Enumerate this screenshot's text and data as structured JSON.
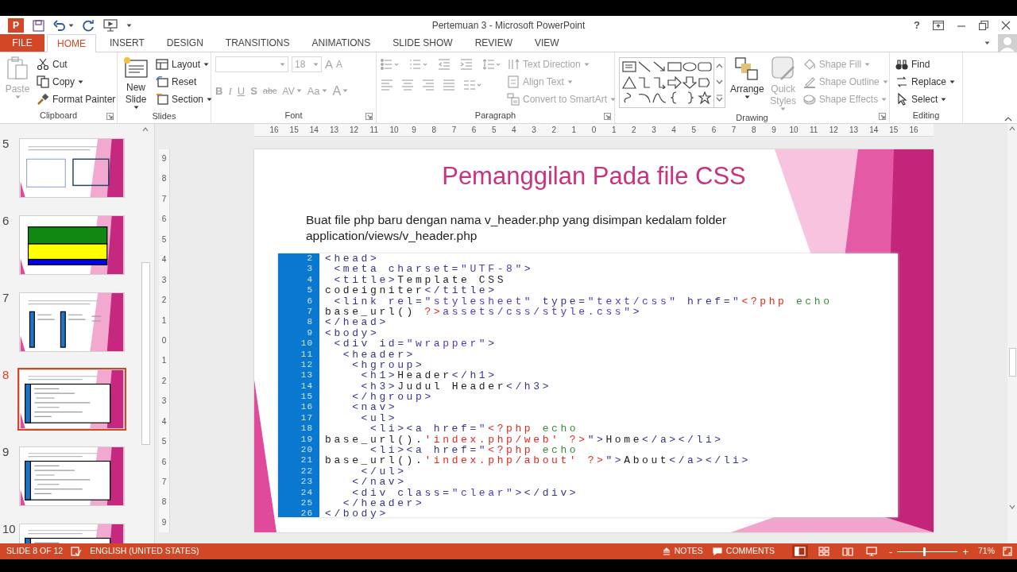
{
  "title_bar": {
    "logo_letter": "P",
    "title": "Pertemuan 3 - Microsoft PowerPoint",
    "help": "?"
  },
  "tabs": [
    {
      "label": "FILE",
      "kind": "file",
      "selected": false
    },
    {
      "label": "HOME",
      "kind": "tab",
      "selected": true
    },
    {
      "label": "INSERT",
      "kind": "tab",
      "selected": false
    },
    {
      "label": "DESIGN",
      "kind": "tab",
      "selected": false
    },
    {
      "label": "TRANSITIONS",
      "kind": "tab",
      "selected": false
    },
    {
      "label": "ANIMATIONS",
      "kind": "tab",
      "selected": false
    },
    {
      "label": "SLIDE SHOW",
      "kind": "tab",
      "selected": false
    },
    {
      "label": "REVIEW",
      "kind": "tab",
      "selected": false
    },
    {
      "label": "VIEW",
      "kind": "tab",
      "selected": false
    }
  ],
  "ribbon": [
    {
      "label": "Clipboard",
      "kind": "clipboard",
      "launcher": true,
      "buttons": [
        {
          "label": "Paste",
          "kind": "large",
          "disabled": true,
          "dropdown": true
        },
        {
          "label": "Cut",
          "kind": "small",
          "disabled": false,
          "dropdown": false
        },
        {
          "label": "Copy",
          "kind": "small",
          "disabled": false,
          "dropdown": true
        },
        {
          "label": "Format Painter",
          "kind": "small",
          "disabled": false,
          "dropdown": false
        }
      ]
    },
    {
      "label": "Slides",
      "kind": "slides",
      "launcher": false,
      "buttons": [
        {
          "label": "New Slide",
          "kind": "large",
          "disabled": false,
          "dropdown": true
        },
        {
          "label": "Layout",
          "kind": "small",
          "disabled": false,
          "dropdown": true
        },
        {
          "label": "Reset",
          "kind": "small",
          "disabled": false,
          "dropdown": false
        },
        {
          "label": "Section",
          "kind": "small",
          "disabled": false,
          "dropdown": true
        }
      ]
    },
    {
      "label": "Font",
      "kind": "font",
      "launcher": true,
      "disabled": true,
      "font_size": "18",
      "glyph_buttons": [
        {
          "text": "A",
          "kind": "grow",
          "dropdown": false
        },
        {
          "text": "A",
          "kind": "shrink",
          "dropdown": false
        },
        {
          "text": "B",
          "kind": "bold",
          "dropdown": false
        },
        {
          "text": "I",
          "kind": "italic",
          "dropdown": false
        },
        {
          "text": "U",
          "kind": "underline",
          "dropdown": false
        },
        {
          "text": "S",
          "kind": "shadow",
          "dropdown": false
        },
        {
          "text": "abc",
          "kind": "strike",
          "dropdown": false
        },
        {
          "text": "AV",
          "kind": "spacing",
          "dropdown": true
        },
        {
          "text": "Aa",
          "kind": "case",
          "dropdown": true
        },
        {
          "text": "A",
          "kind": "color",
          "dropdown": true
        }
      ]
    },
    {
      "label": "Paragraph",
      "kind": "paragraph",
      "launcher": true,
      "disabled": true,
      "buttons": [
        {
          "label": "Text Direction",
          "kind": "small",
          "disabled": true,
          "dropdown": true
        },
        {
          "label": "Align Text",
          "kind": "small",
          "disabled": true,
          "dropdown": true
        },
        {
          "label": "Convert to SmartArt",
          "kind": "small",
          "disabled": true,
          "dropdown": true
        }
      ]
    },
    {
      "label": "Drawing",
      "kind": "drawing",
      "launcher": true,
      "buttons": [
        {
          "label": "Arrange",
          "kind": "large",
          "disabled": false,
          "dropdown": true
        },
        {
          "label": "Quick Styles",
          "kind": "large",
          "disabled": true,
          "dropdown": true
        },
        {
          "label": "Shape Fill",
          "kind": "small",
          "disabled": true,
          "dropdown": true
        },
        {
          "label": "Shape Outline",
          "kind": "small",
          "disabled": true,
          "dropdown": true
        },
        {
          "label": "Shape Effects",
          "kind": "small",
          "disabled": true,
          "dropdown": true
        }
      ]
    },
    {
      "label": "Editing",
      "kind": "editing",
      "launcher": false,
      "buttons": [
        {
          "label": "Find",
          "kind": "small",
          "disabled": false,
          "dropdown": false
        },
        {
          "label": "Replace",
          "kind": "small",
          "disabled": false,
          "dropdown": true
        },
        {
          "label": "Select",
          "kind": "small",
          "disabled": false,
          "dropdown": true
        }
      ]
    }
  ],
  "slides": [
    {
      "number": "5",
      "kind": "diagram",
      "selected": false
    },
    {
      "number": "6",
      "kind": "colors",
      "selected": false
    },
    {
      "number": "7",
      "kind": "columns",
      "selected": false
    },
    {
      "number": "8",
      "kind": "code",
      "selected": true
    },
    {
      "number": "9",
      "kind": "code",
      "selected": false
    },
    {
      "number": "10",
      "kind": "code",
      "selected": false
    }
  ],
  "ruler": {
    "horizontal": [
      "16",
      "15",
      "14",
      "13",
      "12",
      "11",
      "10",
      "9",
      "8",
      "7",
      "6",
      "5",
      "4",
      "3",
      "2",
      "1",
      "0",
      "1",
      "2",
      "3",
      "4",
      "5",
      "6",
      "7",
      "8",
      "9",
      "10",
      "11",
      "12",
      "13",
      "14",
      "15",
      "16"
    ],
    "vertical": [
      "9",
      "8",
      "7",
      "6",
      "5",
      "4",
      "3",
      "2",
      "1",
      "0",
      "1",
      "2",
      "3",
      "4",
      "5",
      "6",
      "7",
      "8",
      "9"
    ]
  },
  "slide": {
    "title": "Pemanggilan Pada file CSS",
    "body": "Buat file php baru dengan nama v_header.php yang disimpan kedalam folder application/views/v_header.php",
    "code": [
      {
        "number": "2",
        "segments": [
          {
            "text": "<head>",
            "kind": "markup"
          }
        ]
      },
      {
        "number": "3",
        "segments": [
          {
            "text": " <meta charset=",
            "kind": "markup"
          },
          {
            "text": "\"UTF-8\"",
            "kind": "string"
          },
          {
            "text": ">",
            "kind": "markup"
          }
        ]
      },
      {
        "number": "4",
        "segments": [
          {
            "text": " <title>",
            "kind": "markup"
          },
          {
            "text": "Template CSS",
            "kind": "text"
          }
        ]
      },
      {
        "number": "5",
        "segments": [
          {
            "text": "codeigniter",
            "kind": "text"
          },
          {
            "text": "</title>",
            "kind": "markup"
          }
        ]
      },
      {
        "number": "6",
        "segments": [
          {
            "text": " <link rel=",
            "kind": "markup"
          },
          {
            "text": "\"stylesheet\"",
            "kind": "string"
          },
          {
            "text": " type=",
            "kind": "markup"
          },
          {
            "text": "\"text/css\"",
            "kind": "string"
          },
          {
            "text": " href=",
            "kind": "markup"
          },
          {
            "text": "\"",
            "kind": "string"
          },
          {
            "text": "<?php",
            "kind": "php"
          },
          {
            "text": " echo",
            "kind": "keyword"
          }
        ]
      },
      {
        "number": "7",
        "segments": [
          {
            "text": "base_url() ",
            "kind": "text"
          },
          {
            "text": "?>",
            "kind": "php"
          },
          {
            "text": "assets/css/style.css\"",
            "kind": "string"
          },
          {
            "text": ">",
            "kind": "markup"
          }
        ]
      },
      {
        "number": "8",
        "segments": [
          {
            "text": "</head>",
            "kind": "markup"
          }
        ]
      },
      {
        "number": "9",
        "segments": [
          {
            "text": "<body>",
            "kind": "markup"
          }
        ]
      },
      {
        "number": "10",
        "segments": [
          {
            "text": " <div id=",
            "kind": "markup"
          },
          {
            "text": "\"wrapper\"",
            "kind": "string"
          },
          {
            "text": ">",
            "kind": "markup"
          }
        ]
      },
      {
        "number": "11",
        "segments": [
          {
            "text": "  <header>",
            "kind": "markup"
          }
        ]
      },
      {
        "number": "12",
        "segments": [
          {
            "text": "   <hgroup>",
            "kind": "markup"
          }
        ]
      },
      {
        "number": "13",
        "segments": [
          {
            "text": "    <h1>",
            "kind": "markup"
          },
          {
            "text": "Header",
            "kind": "text"
          },
          {
            "text": "</h1>",
            "kind": "markup"
          }
        ]
      },
      {
        "number": "14",
        "segments": [
          {
            "text": "    <h3>",
            "kind": "markup"
          },
          {
            "text": "Judul Header",
            "kind": "text"
          },
          {
            "text": "</h3>",
            "kind": "markup"
          }
        ]
      },
      {
        "number": "15",
        "segments": [
          {
            "text": "   </hgroup>",
            "kind": "markup"
          }
        ]
      },
      {
        "number": "16",
        "segments": [
          {
            "text": "   <nav>",
            "kind": "markup"
          }
        ]
      },
      {
        "number": "17",
        "segments": [
          {
            "text": "    <ul>",
            "kind": "markup"
          }
        ]
      },
      {
        "number": "18",
        "segments": [
          {
            "text": "     <li><a href=",
            "kind": "markup"
          },
          {
            "text": "\"",
            "kind": "string"
          },
          {
            "text": "<?php",
            "kind": "php"
          },
          {
            "text": " echo",
            "kind": "keyword"
          }
        ]
      },
      {
        "number": "19",
        "segments": [
          {
            "text": "base_url().",
            "kind": "text"
          },
          {
            "text": "'index.php/web' ?>",
            "kind": "php"
          },
          {
            "text": "\">",
            "kind": "markup"
          },
          {
            "text": "Home",
            "kind": "text"
          },
          {
            "text": "</a></li>",
            "kind": "markup"
          }
        ]
      },
      {
        "number": "20",
        "segments": [
          {
            "text": "     <li><a href=",
            "kind": "markup"
          },
          {
            "text": "\"",
            "kind": "string"
          },
          {
            "text": "<?php",
            "kind": "php"
          },
          {
            "text": " echo",
            "kind": "keyword"
          }
        ]
      },
      {
        "number": "21",
        "segments": [
          {
            "text": "base_url().",
            "kind": "text"
          },
          {
            "text": "'index.php/about' ?>",
            "kind": "php"
          },
          {
            "text": "\">",
            "kind": "markup"
          },
          {
            "text": "About",
            "kind": "text"
          },
          {
            "text": "</a></li>",
            "kind": "markup"
          }
        ]
      },
      {
        "number": "22",
        "segments": [
          {
            "text": "    </ul>",
            "kind": "markup"
          }
        ]
      },
      {
        "number": "23",
        "segments": [
          {
            "text": "   </nav>",
            "kind": "markup"
          }
        ]
      },
      {
        "number": "24",
        "segments": [
          {
            "text": "   <div class=",
            "kind": "markup"
          },
          {
            "text": "\"clear\"",
            "kind": "string"
          },
          {
            "text": "></div>",
            "kind": "markup"
          }
        ]
      },
      {
        "number": "25",
        "segments": [
          {
            "text": "  </header>",
            "kind": "markup"
          }
        ]
      },
      {
        "number": "26",
        "segments": [
          {
            "text": "</body>",
            "kind": "markup"
          }
        ]
      }
    ]
  },
  "status_bar": {
    "slide_info": "SLIDE 8 OF 12",
    "language": "ENGLISH (UNITED STATES)",
    "notes": "NOTES",
    "comments": "COMMENTS",
    "views": [
      {
        "kind": "normal",
        "selected": true
      },
      {
        "kind": "sorter",
        "selected": false
      },
      {
        "kind": "reading",
        "selected": false
      },
      {
        "kind": "slideshow",
        "selected": false
      }
    ],
    "zoom_out": "-",
    "zoom_in": "+",
    "zoom": {
      "level": 0.44
    },
    "zoom_reading": "71%"
  }
}
